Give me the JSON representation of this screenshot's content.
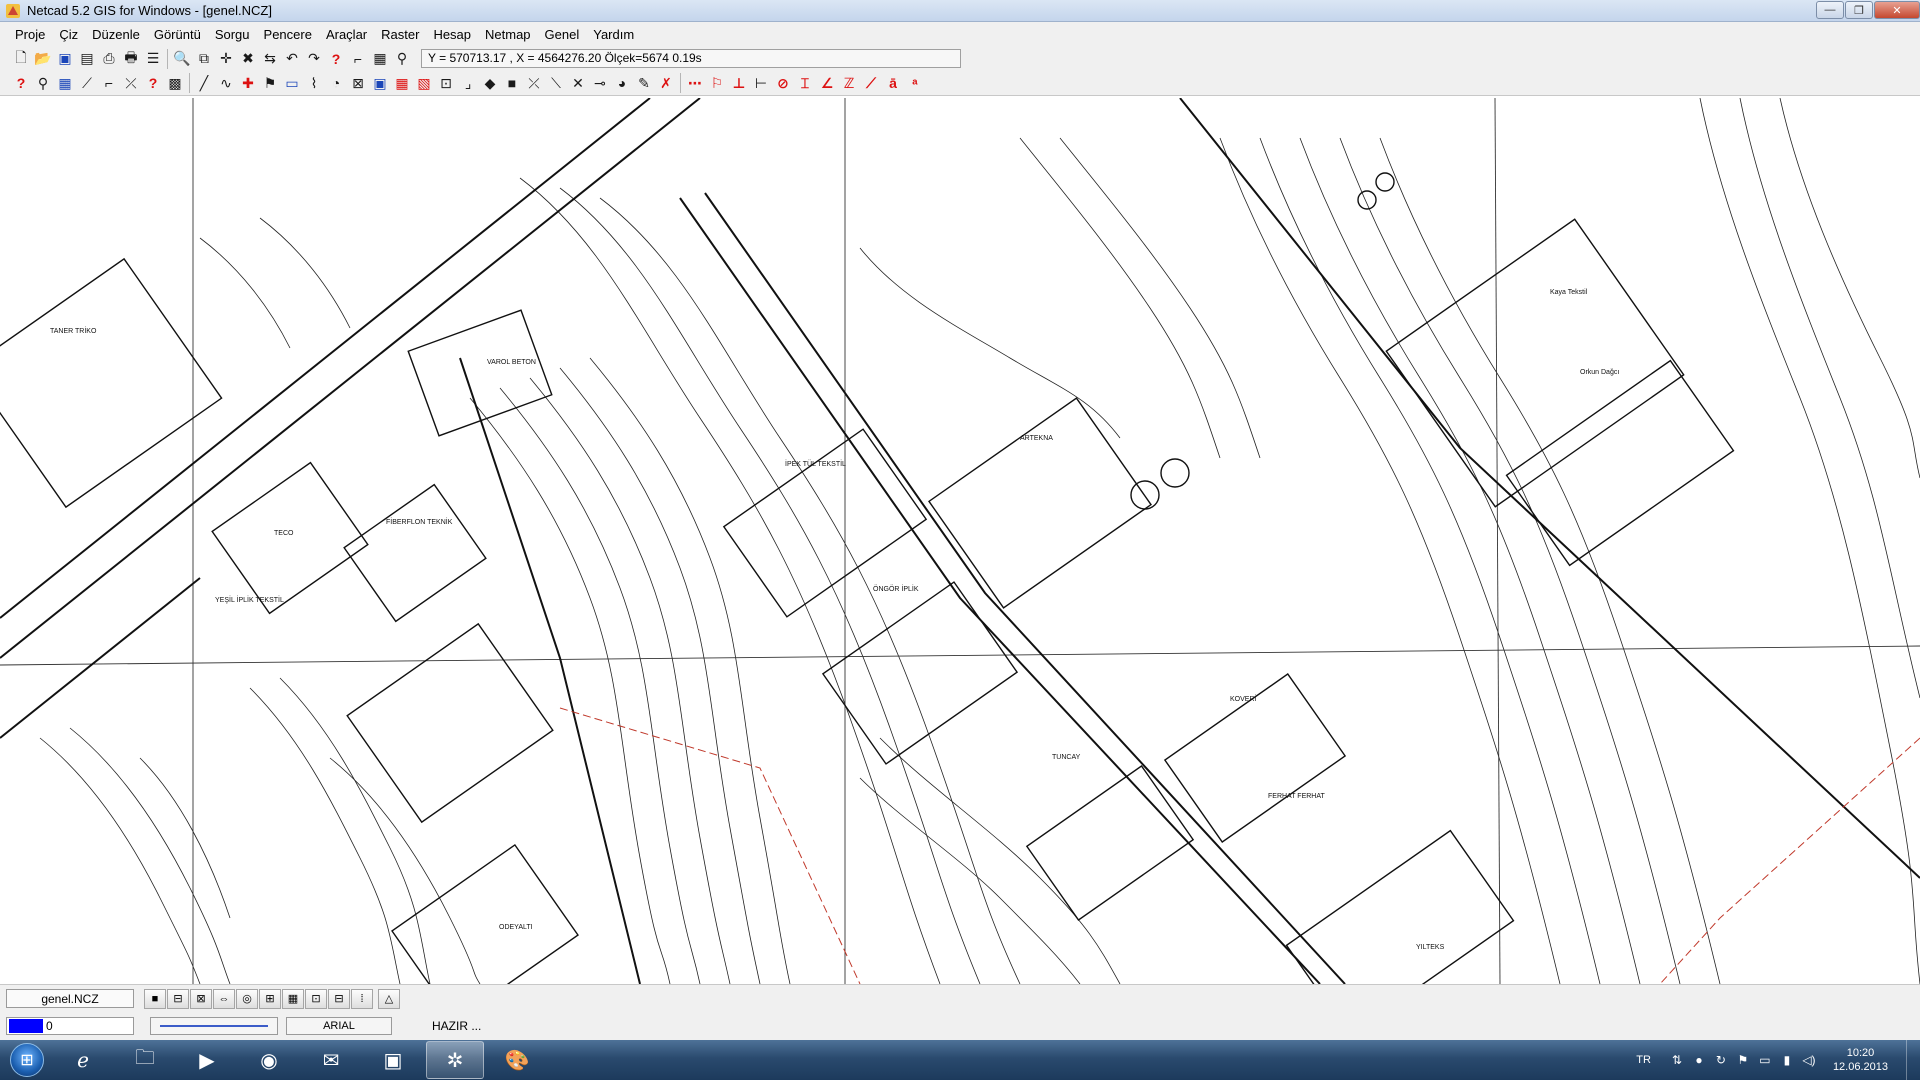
{
  "window": {
    "title": "Netcad 5.2 GIS for Windows - [genel.NCZ]",
    "buttons": {
      "minimize": "—",
      "maximize": "❐",
      "close": "✕"
    }
  },
  "menu": [
    {
      "label": "Proje"
    },
    {
      "label": "Çiz"
    },
    {
      "label": "Düzenle"
    },
    {
      "label": "Görüntü"
    },
    {
      "label": "Sorgu"
    },
    {
      "label": "Pencere"
    },
    {
      "label": "Araçlar"
    },
    {
      "label": "Raster"
    },
    {
      "label": "Hesap"
    },
    {
      "label": "Netmap"
    },
    {
      "label": "Genel"
    },
    {
      "label": "Yardım"
    }
  ],
  "toolbar": {
    "coordinates": "Y = 570713.17 , X = 4564276.20  Ölçek=5674   0.19s"
  },
  "map": {
    "labels": {
      "taner": "TANER TRİKO",
      "varol": "VAROL BETON",
      "ipek": "İPEK TÜL TEKSTİL",
      "fiberflon": "FİBERFLON TEKNİK",
      "teco": "TECO",
      "yesil": "YEŞİL İPLİK TEKSTİL",
      "ongor": "ÖNGÖR İPLİK",
      "artekna": "ARTEKNA",
      "kaya": "Kaya Tekstil",
      "orkun": "Orkun Dağcı",
      "koveri": "KOVERİ",
      "tuncay": "TUNCAY",
      "yilteks": "YILTEKS",
      "odeyalti": "ODEYALTI",
      "ferhat": "FERHAT FERHAT"
    }
  },
  "bottom": {
    "file_tab": "genel.NCZ",
    "layer": "0",
    "layer_color": "#0000ff",
    "font": "ARIAL",
    "status": "HAZIR ..."
  },
  "taskbar": {
    "lang": "TR",
    "time": "10:20",
    "date": "12.06.2013"
  }
}
